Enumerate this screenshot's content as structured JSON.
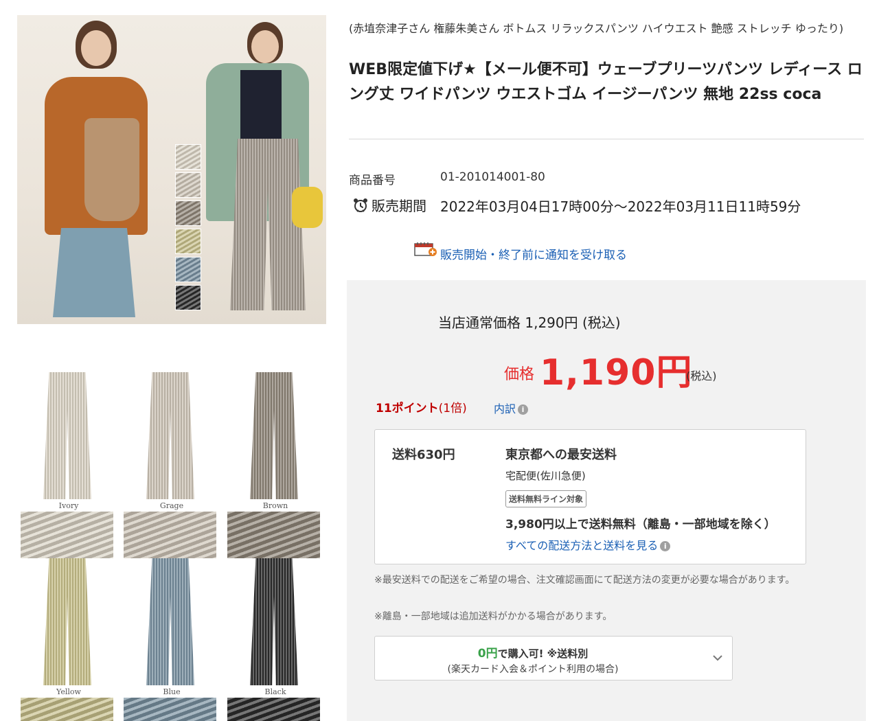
{
  "product": {
    "catch_copy": "(赤埴奈津子さん 権藤朱美さん ボトムス リラックスパンツ ハイウエスト 艶感 ストレッチ ゆったり)",
    "title": "WEB限定値下げ★【メール便不可】ウェーブプリーツパンツ レディース ロング丈 ワイドパンツ ウエストゴム イージーパンツ 無地 22ss coca",
    "number_label": "商品番号",
    "number_value": "01-201014001-80",
    "period_label": "販売期間",
    "period_value": "2022年03月04日17時00分〜2022年03月11日11時59分",
    "notify_link": "販売開始・終了前に通知を受け取る"
  },
  "colors": {
    "price_red": "#e62e2e",
    "points_red": "#bf0000",
    "link_blue": "#1a5fb4",
    "offer_green": "#3aa24a"
  },
  "variants": [
    {
      "name": "Ivory",
      "color": "#d9d2c3"
    },
    {
      "name": "Grage",
      "color": "#cdc4b6"
    },
    {
      "name": "Brown",
      "color": "#8f8578"
    },
    {
      "name": "Yellow",
      "color": "#c7bf8a"
    },
    {
      "name": "Blue",
      "color": "#7890a0"
    },
    {
      "name": "Black",
      "color": "#2c2c2c"
    }
  ],
  "price": {
    "normal": "当店通常価格 1,290円 (税込)",
    "label": "価格",
    "value": "1,190円",
    "tax": "(税込)",
    "points": "11ポイント",
    "points_multiplier": "(1倍)",
    "breakdown": "内訳"
  },
  "shipping": {
    "fee": "送料630円",
    "cheapest": "東京都への最安送料",
    "carrier": "宅配便(佐川急便)",
    "badge": "送料無料ライン対象",
    "free_line": "3,980円以上で送料無料（離島・一部地域を除く）",
    "all_methods": "すべての配送方法と送料を見る",
    "note1": "※最安送料での配送をご希望の場合、注文確認画面にて配送方法の変更が必要な場合があります。",
    "note2": "※離島・一部地域は追加送料がかかる場合があります。"
  },
  "card_offer": {
    "zero": "0円",
    "line1_rest": "で購入可! ※送料別",
    "line2": "(楽天カード入会＆ポイント利用の場合)"
  }
}
